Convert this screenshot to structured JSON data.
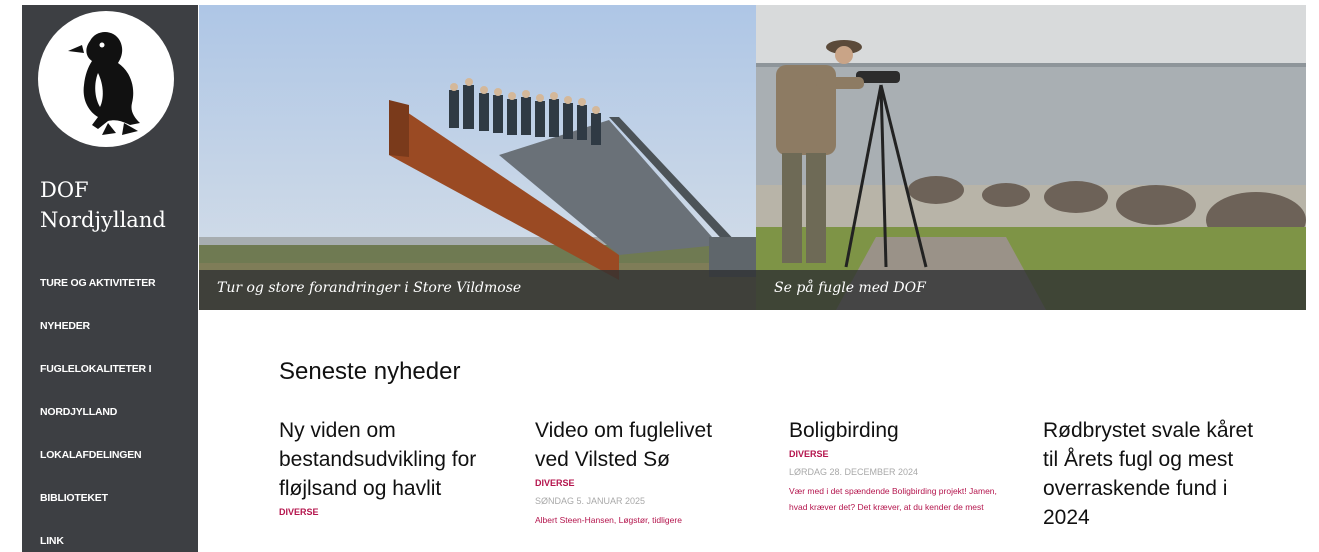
{
  "site": {
    "title": "DOF Nordjylland"
  },
  "nav": [
    "TURE OG AKTIVITETER",
    "NYHEDER",
    "FUGLELOKALITETER I",
    "NORDJYLLAND",
    "LOKALAFDELINGEN",
    "BIBLIOTEKET",
    "LINK"
  ],
  "hero": {
    "slides": [
      {
        "caption": "Tur og store forandringer i Store Vildmose"
      },
      {
        "caption": "Se på fugle med DOF"
      }
    ]
  },
  "news": {
    "heading": "Seneste nyheder",
    "items": [
      {
        "title": "Ny viden om bestandsudvikling for fløjlsand og havlit",
        "category": "DIVERSE",
        "date": "",
        "excerpt": ""
      },
      {
        "title": "Video om fuglelivet ved Vilsted Sø",
        "category": "DIVERSE",
        "date": "SØNDAG 5. JANUAR 2025",
        "excerpt": "Albert Steen-Hansen, Løgstør, tidligere"
      },
      {
        "title": "Boligbirding",
        "category": "DIVERSE",
        "date": "LØRDAG 28. DECEMBER 2024",
        "excerpt": "Vær med i det spændende Boligbirding projekt! Jamen, hvad kræver det? Det kræver, at du kender de mest"
      },
      {
        "title": "Rødbrystet svale kåret til Årets fugl og mest overraskende fund i 2024",
        "category": "",
        "date": "",
        "excerpt": ""
      }
    ]
  },
  "colors": {
    "sidebar": "#3d3f43",
    "accent": "#b4154d",
    "date": "#a9a9a9"
  }
}
